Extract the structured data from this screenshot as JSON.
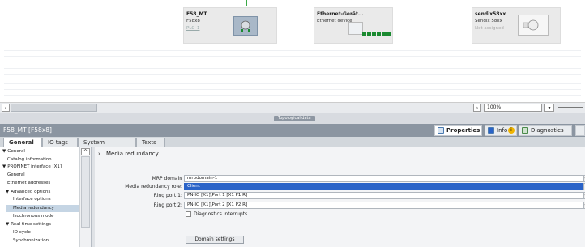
{
  "devices": [
    {
      "name": "F58_MT",
      "type": "F58x8",
      "link": "PLC_1"
    },
    {
      "name": "Ethernet-Gerät...",
      "type": "Ethernet device",
      "link": ""
    },
    {
      "name": "sendix58xx",
      "type": "Sendix 58xx",
      "link": "Not assigned"
    }
  ],
  "zoom": {
    "value": "100%"
  },
  "view_tab": {
    "label": "Topological data"
  },
  "inspector": {
    "title": "F58_MT [F58x8]",
    "tabs": [
      {
        "label": "Properties"
      },
      {
        "label": "Info"
      },
      {
        "label": "Diagnostics"
      }
    ]
  },
  "subtabs": [
    {
      "label": "General"
    },
    {
      "label": "IO tags"
    },
    {
      "label": "System constants"
    },
    {
      "label": "Texts"
    }
  ],
  "nav": [
    {
      "label": "General",
      "arrow": "▼"
    },
    {
      "label": "Catalog information",
      "arrow": ""
    },
    {
      "label": "PROFINET interface [X1]",
      "arrow": "▼"
    },
    {
      "label": "General",
      "arrow": ""
    },
    {
      "label": "Ethernet addresses",
      "arrow": ""
    },
    {
      "label": "Advanced options",
      "arrow": "▼"
    },
    {
      "label": "Interface options",
      "arrow": ""
    },
    {
      "label": "Media redundancy",
      "arrow": ""
    },
    {
      "label": "Isochronous mode",
      "arrow": ""
    },
    {
      "label": "Real time settings",
      "arrow": "▼"
    },
    {
      "label": "IO cycle",
      "arrow": ""
    },
    {
      "label": "Synchronization",
      "arrow": ""
    }
  ],
  "section": {
    "arrow": "›",
    "title": "Media redundancy"
  },
  "form": {
    "mrp_domain": {
      "label": "MRP domain",
      "value": "mrpdomain-1"
    },
    "role": {
      "label": "Media redundancy role:",
      "value": "Client"
    },
    "ring1": {
      "label": "Ring port 1:",
      "value": "PN-IO [X1]\\Port 1 [X1 P1 R]"
    },
    "ring2": {
      "label": "Ring port 2:",
      "value": "PN-IO [X1]\\Port 2 [X1 P2 R]"
    },
    "diag": {
      "label": "Diagnostics interrupts"
    },
    "domain_btn": {
      "label": "Domain settings"
    }
  }
}
